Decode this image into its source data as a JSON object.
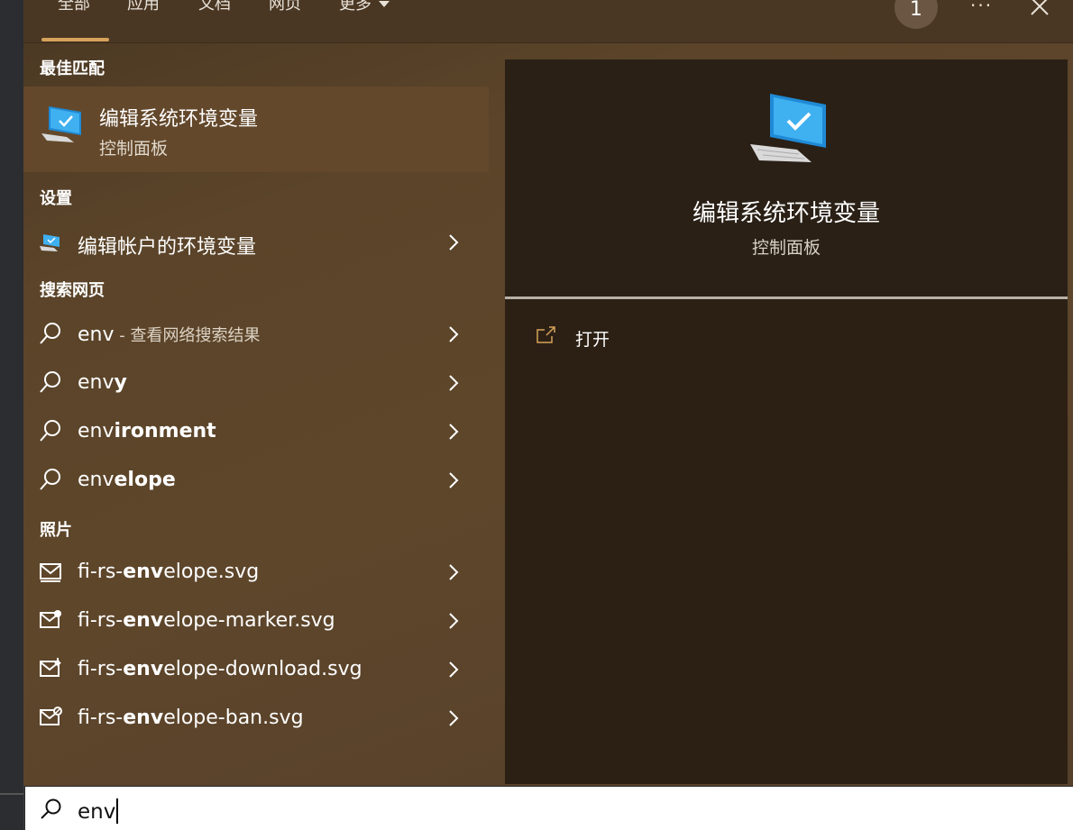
{
  "tabs": [
    {
      "label": "全部"
    },
    {
      "label": "应用"
    },
    {
      "label": "文档"
    },
    {
      "label": "网页"
    },
    {
      "label": "更多"
    }
  ],
  "header": {
    "badge": "1",
    "more_dots": "···",
    "close_icon": "close-icon"
  },
  "sections": {
    "best_match": "最佳匹配",
    "settings": "设置",
    "web": "搜索网页",
    "photos": "照片"
  },
  "best_match": {
    "title": "编辑系统环境变量",
    "subtitle": "控制面板",
    "icon": "monitor-check-icon"
  },
  "settings_items": [
    {
      "label": "编辑帐户的环境变量",
      "icon": "monitor-settings-icon"
    }
  ],
  "web_items": [
    {
      "prefix": "env",
      "suffix": "",
      "hint": " - 查看网络搜索结果"
    },
    {
      "prefix": "env",
      "suffix": "y",
      "hint": ""
    },
    {
      "prefix": "env",
      "suffix": "ironment",
      "hint": ""
    },
    {
      "prefix": "env",
      "suffix": "elope",
      "hint": ""
    }
  ],
  "photo_items": [
    {
      "before": "fi-rs-",
      "bold": "env",
      "after": "elope.svg",
      "icon": "envelope-icon"
    },
    {
      "before": "fi-rs-",
      "bold": "env",
      "after": "elope-marker.svg",
      "icon": "envelope-marker-icon"
    },
    {
      "before": "fi-rs-",
      "bold": "env",
      "after": "elope-download.svg",
      "icon": "envelope-download-icon"
    },
    {
      "before": "fi-rs-",
      "bold": "env",
      "after": "elope-ban.svg",
      "icon": "envelope-ban-icon"
    }
  ],
  "detail": {
    "title": "编辑系统环境变量",
    "subtitle": "控制面板",
    "action_open": "打开"
  },
  "search": {
    "value": "env"
  },
  "colors": {
    "accent": "#d7a35a",
    "panel": "#5e462b",
    "detail_bg": "#2c2015"
  }
}
